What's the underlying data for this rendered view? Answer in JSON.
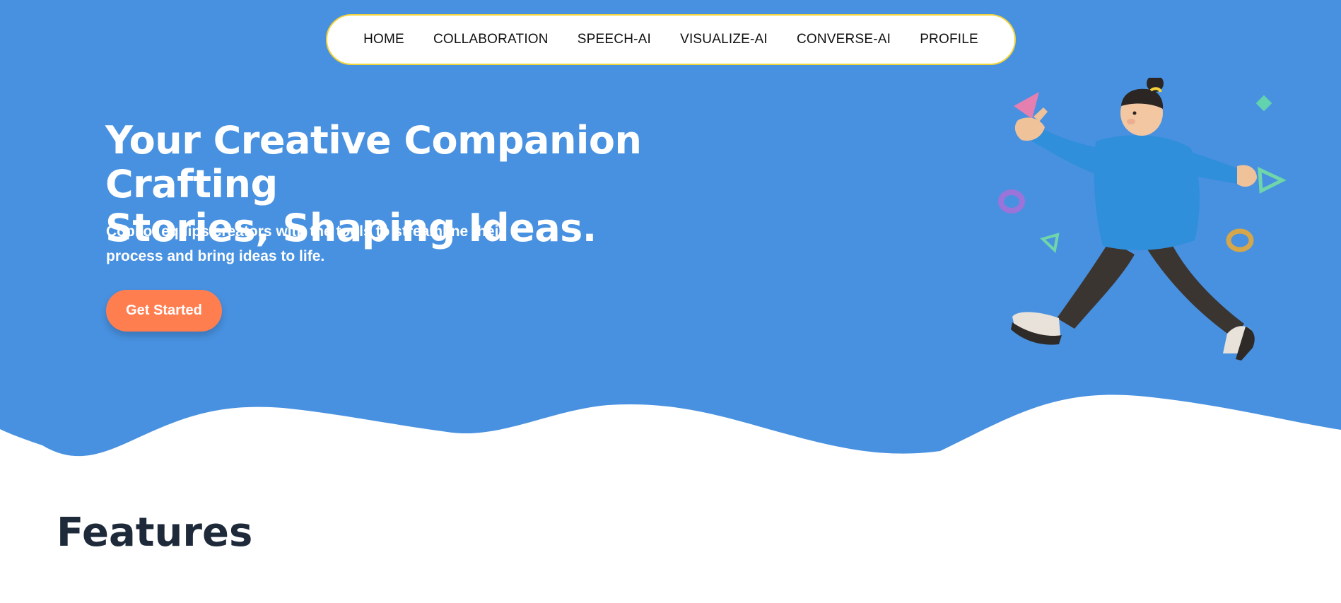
{
  "colors": {
    "hero_background": "#4891e0",
    "nav_border": "#f0d33a",
    "cta_background": "#ff7e50",
    "heading_dark": "#1e2a3a"
  },
  "nav": {
    "items": [
      {
        "label": "HOME"
      },
      {
        "label": "COLLABORATION"
      },
      {
        "label": "SPEECH-AI"
      },
      {
        "label": "VISUALIZE-AI"
      },
      {
        "label": "CONVERSE-AI"
      },
      {
        "label": "PROFILE"
      }
    ]
  },
  "hero": {
    "title_line1": "Your Creative Companion Crafting",
    "title_line2": "Stories, Shaping Ideas.",
    "subtitle_line1": "Copilot equips creators with the tools to streamline their",
    "subtitle_line2": "process and bring ideas to life.",
    "cta_label": "Get Started",
    "illustration": "walking-person-3d-illustration"
  },
  "features": {
    "heading": "Features"
  }
}
